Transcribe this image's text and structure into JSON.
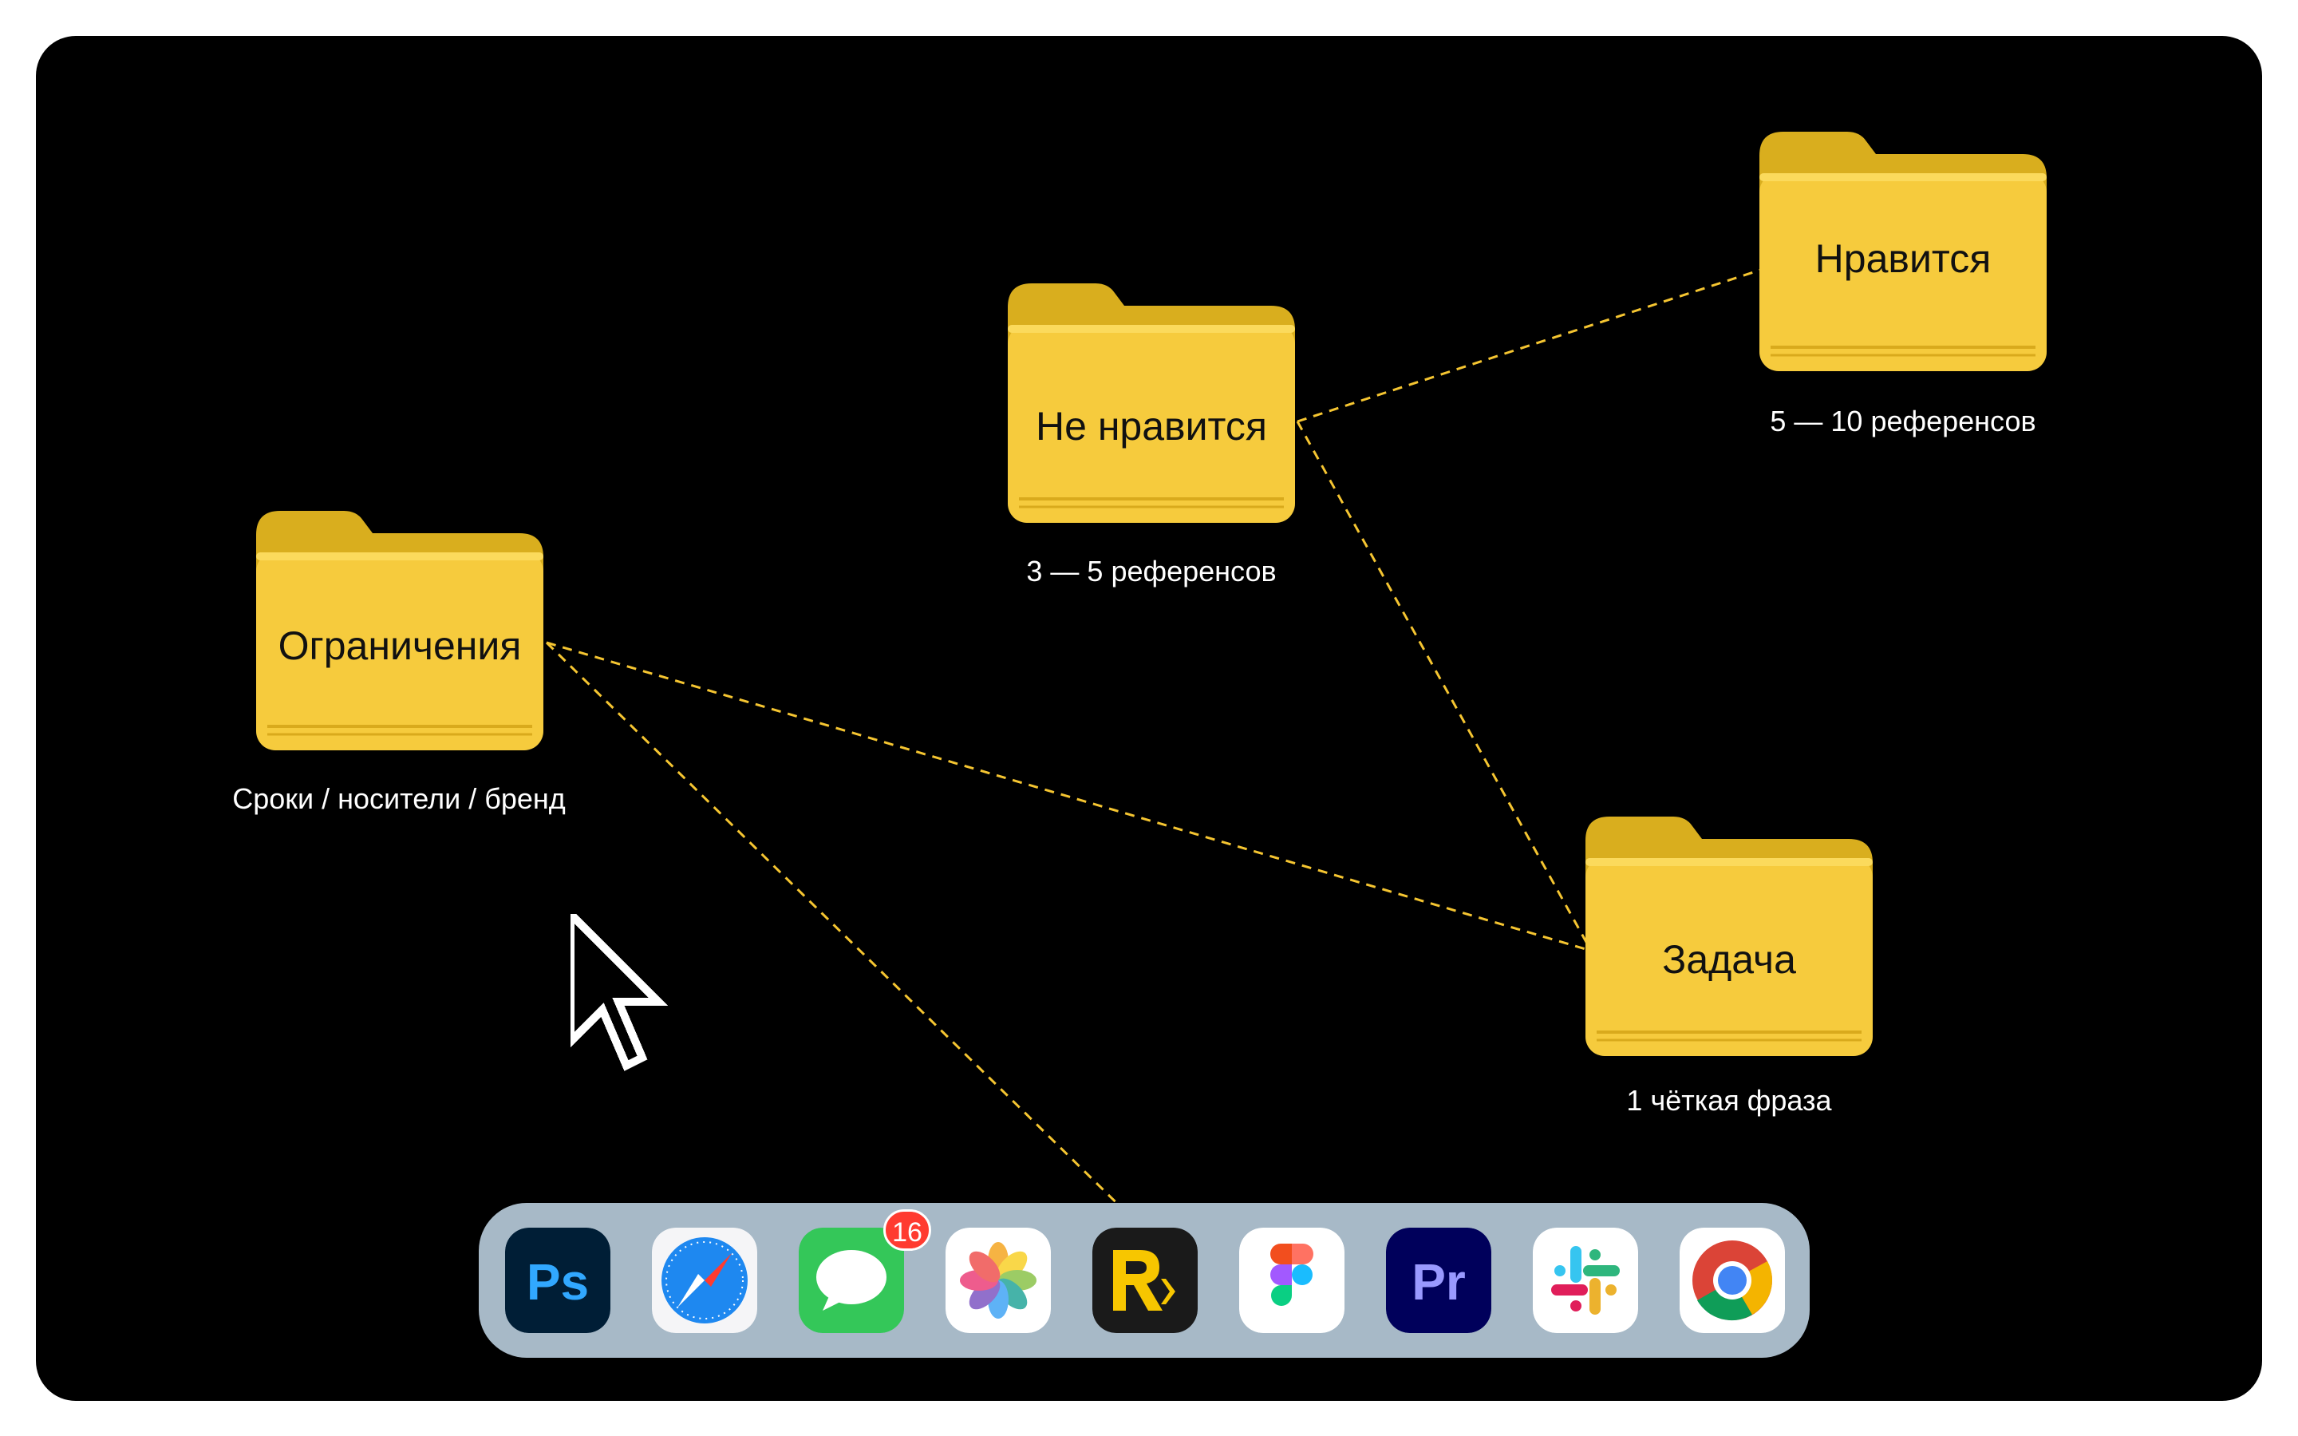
{
  "colors": {
    "accent": "#F5C531",
    "connector": "#F5C531",
    "desktop_bg": "#000000",
    "dock_bg": "#A7B9C7",
    "badge": "#FF3B30"
  },
  "folders": [
    {
      "id": "likes",
      "label": "Нравится",
      "caption": "5 — 10 референсов",
      "icon": "folder-icon"
    },
    {
      "id": "dislikes",
      "label": "Не нравится",
      "caption": "3 — 5 референсов",
      "icon": "folder-icon"
    },
    {
      "id": "limits",
      "label": "Ограничения",
      "caption": "Сроки / носители / бренд",
      "icon": "folder-icon"
    },
    {
      "id": "task",
      "label": "Задача",
      "caption": "1 чёткая фраза",
      "icon": "folder-icon"
    }
  ],
  "dock": {
    "apps": [
      {
        "name": "Photoshop",
        "icon": "photoshop-icon"
      },
      {
        "name": "Safari",
        "icon": "safari-icon"
      },
      {
        "name": "Messages",
        "icon": "messages-icon",
        "badge": "16"
      },
      {
        "name": "Photos",
        "icon": "photos-icon"
      },
      {
        "name": "Rakuten",
        "icon": "rakuten-r-icon"
      },
      {
        "name": "Figma",
        "icon": "figma-icon"
      },
      {
        "name": "Premiere Pro",
        "icon": "premiere-pro-icon"
      },
      {
        "name": "Slack",
        "icon": "slack-icon"
      },
      {
        "name": "Chrome",
        "icon": "chrome-icon"
      }
    ],
    "ps_text": "Ps",
    "pr_text": "Pr"
  },
  "cursor": {
    "icon": "arrow-cursor-icon"
  }
}
